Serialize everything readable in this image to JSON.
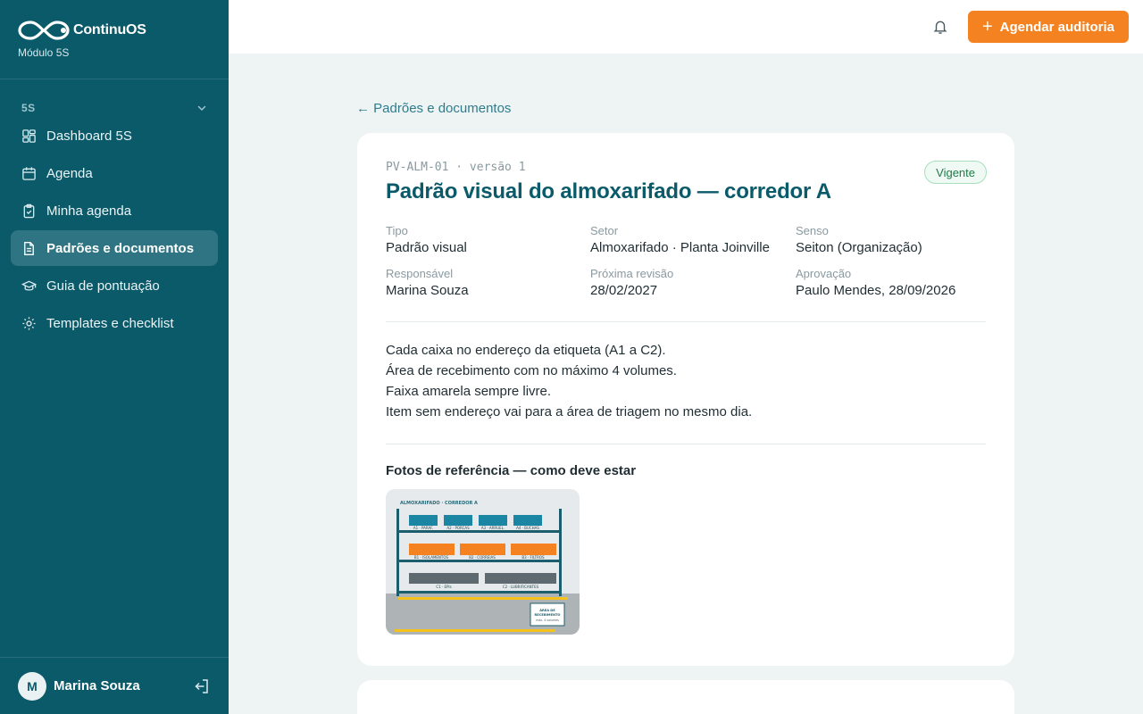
{
  "brand": {
    "name": "ContinuOS",
    "subtitle": "Módulo 5S"
  },
  "sidebar": {
    "section": "5S",
    "items": [
      {
        "label": "Dashboard 5S",
        "icon": "dashboard-icon"
      },
      {
        "label": "Agenda",
        "icon": "calendar-icon"
      },
      {
        "label": "Minha agenda",
        "icon": "clipboard-check-icon"
      },
      {
        "label": "Padrões e documentos",
        "icon": "document-icon",
        "active": true
      },
      {
        "label": "Guia de pontuação",
        "icon": "graduation-cap-icon"
      },
      {
        "label": "Templates e checklist",
        "icon": "gear-icon"
      }
    ]
  },
  "user": {
    "initial": "M",
    "name": "Marina Souza"
  },
  "topbar": {
    "primary_button": "Agendar auditoria"
  },
  "page": {
    "back_link": "← Padrões e documentos",
    "code": "PV-ALM-01 · versão 1",
    "title": "Padrão visual do almoxarifado — corredor A",
    "status": "Vigente",
    "meta": [
      {
        "key": "Tipo",
        "value": "Padrão visual"
      },
      {
        "key": "Setor",
        "value": "Almoxarifado · Planta Joinville"
      },
      {
        "key": "Senso",
        "value": "Seiton (Organização)"
      },
      {
        "key": "Responsável",
        "value": "Marina Souza"
      },
      {
        "key": "Próxima revisão",
        "value": "28/02/2027"
      },
      {
        "key": "Aprovação",
        "value": "Paulo Mendes, 28/09/2026"
      }
    ],
    "description": [
      "Cada caixa no endereço da etiqueta (A1 a C2).",
      "Área de recebimento com no máximo 4 volumes.",
      "Faixa amarela sempre livre.",
      "Item sem endereço vai para a área de triagem no mesmo dia."
    ],
    "photos_title": "Fotos de referência — como deve estar",
    "photo": {
      "heading": "ALMOXARIFADO · CORREDOR A",
      "row_a": [
        "A1 · PARAF.",
        "A2 · PORCAS",
        "A3 · ARRUEL.",
        "A4 · BUCHAS"
      ],
      "row_b": [
        "B1 · ISOLAMENTOS",
        "B2 · CORREIAS",
        "B3 · FILTROS"
      ],
      "row_c": [
        "C1 · EPIs",
        "C2 · LUBRIFICANTES"
      ],
      "area_label_1": "ÁREA DE",
      "area_label_2": "RECEBIMENTO",
      "area_label_3": "máx. 4 volumes"
    }
  },
  "colors": {
    "sidebar": "#0a5a6a",
    "accent": "#f58220",
    "active_item": "#2f7483",
    "title": "#0a5a6a"
  }
}
